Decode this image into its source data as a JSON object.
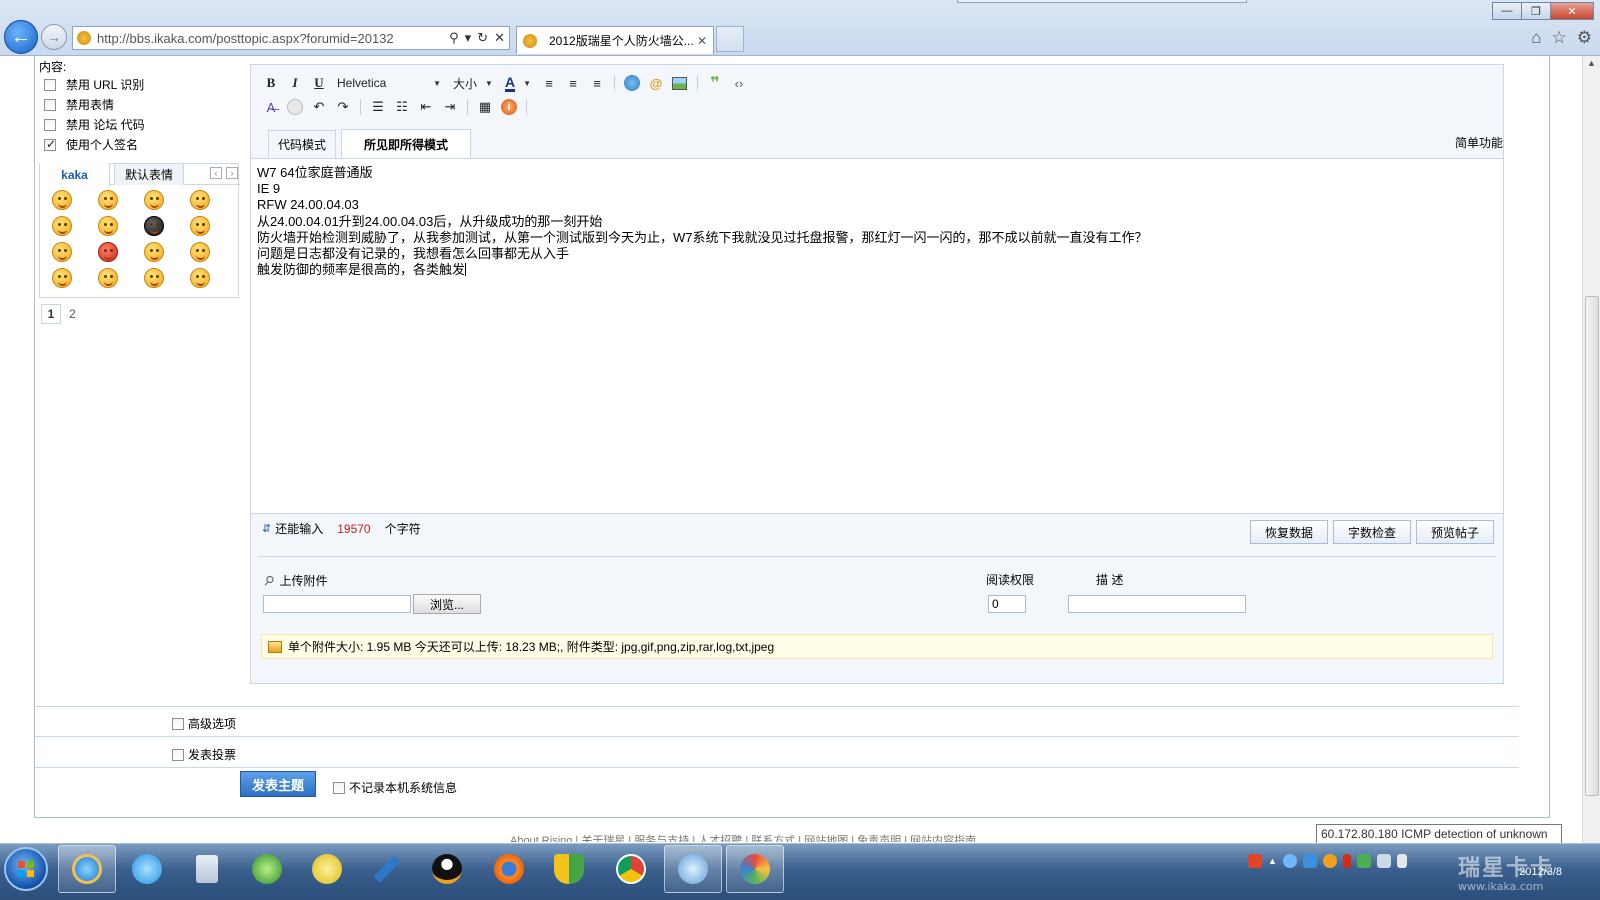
{
  "browser": {
    "url": "http://bbs.ikaka.com/posttopic.aspx?forumid=20132",
    "tab_title": "2012版瑞星个人防火墙公...",
    "tab_close": "✕",
    "address_tools": [
      "⚲",
      "▾",
      "↻",
      "✕"
    ],
    "window_controls": [
      "—",
      "❐",
      "✕"
    ],
    "right_icons": [
      "⌂",
      "☆",
      "⚙"
    ]
  },
  "left": {
    "content_label": "内容:",
    "options": [
      {
        "label": "禁用 URL 识别",
        "checked": false
      },
      {
        "label": "禁用表情",
        "checked": false
      },
      {
        "label": "禁用 论坛 代码",
        "checked": false
      },
      {
        "label": "使用个人签名",
        "checked": true
      }
    ],
    "smiley_tabs": [
      "kaka",
      "默认表情"
    ],
    "pages": [
      "1",
      "2"
    ]
  },
  "toolbar": {
    "font": "Helvetica",
    "size": "大小",
    "font_color": "A"
  },
  "editor": {
    "mode_tabs": [
      "代码模式",
      "所见即所得模式"
    ],
    "simple_func": "简单功能",
    "lines": [
      "W7 64位家庭普通版",
      "IE 9",
      "RFW 24.00.04.03",
      "从24.00.04.01升到24.00.04.03后，从升级成功的那一刻开始",
      "防火墙开始检测到威胁了，从我参加测试，从第一个测试版到今天为止，W7系统下我就没见过托盘报警，那红灯一闪一闪的，那不成以前就一直没有工作？",
      "问题是日志都没有记录的，我想看怎么回事都无从入手",
      "触发防御的频率是很高的，各类触发"
    ]
  },
  "counter": {
    "prefix": "还能输入",
    "value": "19570",
    "suffix": "个字符"
  },
  "actions": [
    "恢复数据",
    "字数检查",
    "预览帖子"
  ],
  "upload": {
    "label": "上传附件",
    "browse": "浏览...",
    "perm_label": "阅读权限",
    "desc_label": "描 述",
    "perm_value": "0",
    "notice": "单个附件大小: 1.95 MB  今天还可以上传: 18.23 MB;,  附件类型: jpg,gif,png,zip,rar,log,txt,jpeg"
  },
  "bottom": {
    "advanced": "高级选项",
    "poll": "发表投票",
    "submit": "发表主题",
    "nolog": "不记录本机系统信息",
    "footer": "About Rising | 关于瑞星 | 服务与支持 | 人才招聘 | 联系方式 | 网站地图 | 免责声明 | 网站内容指南"
  },
  "tooltip": "60.172.80.180 ICMP detection of unknown",
  "clock": {
    "time": "",
    "date": "2012/3/8"
  },
  "watermark": {
    "title": "瑞星卡卡",
    "url": "www.ikaka.com"
  }
}
